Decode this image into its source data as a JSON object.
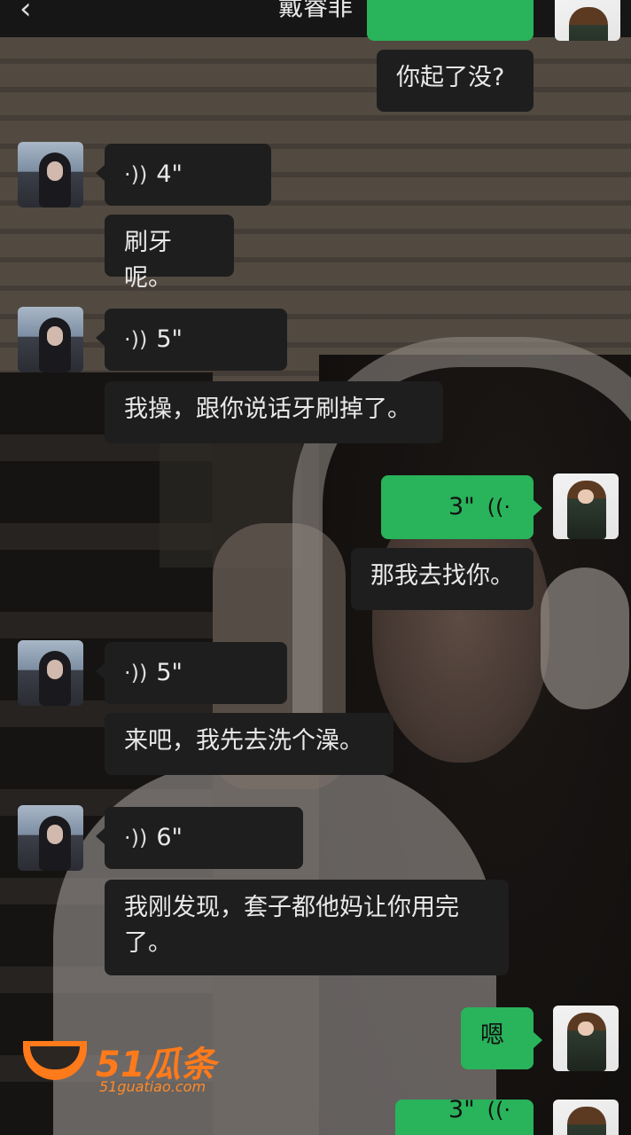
{
  "header": {
    "back_icon": "‹",
    "title": "戴睿菲",
    "more_icon": "···"
  },
  "messages": [
    {
      "id": "m1",
      "side": "right",
      "type": "text",
      "text": "你起了没?"
    },
    {
      "id": "m2",
      "side": "left",
      "type": "voice",
      "duration": "4\""
    },
    {
      "id": "m3",
      "side": "left",
      "type": "text",
      "text": "刷牙呢。"
    },
    {
      "id": "m4",
      "side": "left",
      "type": "voice",
      "duration": "5\""
    },
    {
      "id": "m5",
      "side": "left",
      "type": "text",
      "text": "我操，跟你说话牙刷掉了。"
    },
    {
      "id": "m6",
      "side": "right",
      "type": "voice",
      "duration": "3\""
    },
    {
      "id": "m7",
      "side": "right",
      "type": "text",
      "text": "那我去找你。"
    },
    {
      "id": "m8",
      "side": "left",
      "type": "voice",
      "duration": "5\""
    },
    {
      "id": "m9",
      "side": "left",
      "type": "text",
      "text": "来吧，我先去洗个澡。"
    },
    {
      "id": "m10",
      "side": "left",
      "type": "voice",
      "duration": "6\""
    },
    {
      "id": "m11",
      "side": "left",
      "type": "text",
      "text": "我刚发现，套子都他妈让你用完了。"
    },
    {
      "id": "m12",
      "side": "right",
      "type": "text",
      "text": "嗯"
    },
    {
      "id": "m13",
      "side": "right",
      "type": "voice",
      "duration": "3\""
    }
  ],
  "icons": {
    "voice_wave_left": "·))",
    "voice_wave_right": "((·"
  },
  "watermark": {
    "name": "51瓜条",
    "url": "51guatiao.com"
  },
  "colors": {
    "my_bubble": "#29b35a",
    "their_bubble": "#1e1e1e",
    "watermark": "#ff7a1a"
  }
}
